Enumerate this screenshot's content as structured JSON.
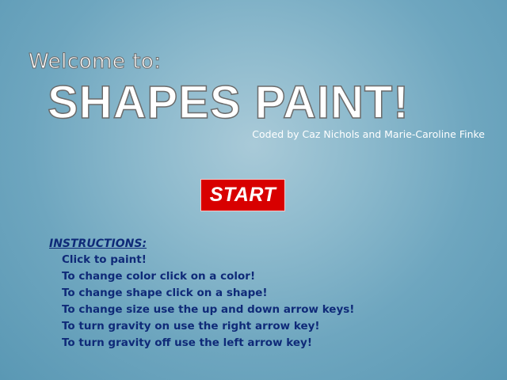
{
  "header": {
    "welcome": "Welcome to:",
    "title": "SHAPES PAINT!",
    "credits": "Coded by Caz Nichols and Marie-Caroline Finke"
  },
  "start_button": {
    "label": "START",
    "color": "#d80000"
  },
  "instructions": {
    "heading": "INSTRUCTIONS:",
    "items": [
      "Click to paint!",
      "To change color click on a color!",
      "To change shape click on a shape!",
      "To change size use the up and down arrow keys!",
      "To turn gravity on use the right arrow key!",
      "To turn gravity off use the left arrow key!"
    ]
  },
  "colors": {
    "background": "#8dbacd",
    "instructions_text": "#0f2a78"
  }
}
